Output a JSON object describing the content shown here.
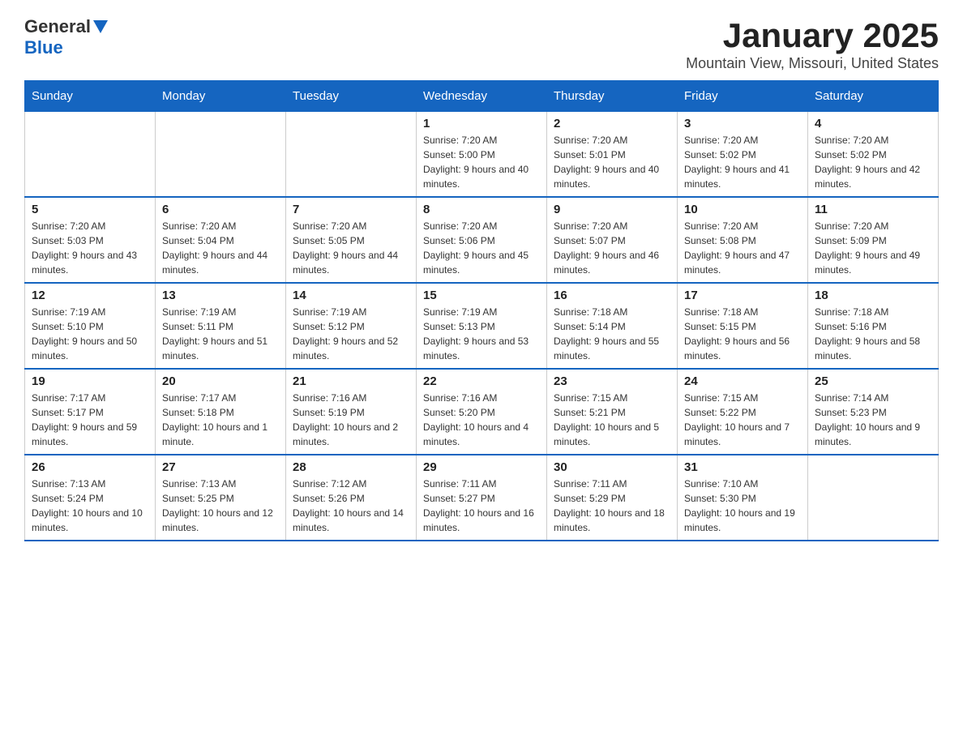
{
  "logo": {
    "text_general": "General",
    "text_blue": "Blue"
  },
  "title": "January 2025",
  "subtitle": "Mountain View, Missouri, United States",
  "days_of_week": [
    "Sunday",
    "Monday",
    "Tuesday",
    "Wednesday",
    "Thursday",
    "Friday",
    "Saturday"
  ],
  "weeks": [
    [
      {
        "day": "",
        "info": ""
      },
      {
        "day": "",
        "info": ""
      },
      {
        "day": "",
        "info": ""
      },
      {
        "day": "1",
        "info": "Sunrise: 7:20 AM\nSunset: 5:00 PM\nDaylight: 9 hours and 40 minutes."
      },
      {
        "day": "2",
        "info": "Sunrise: 7:20 AM\nSunset: 5:01 PM\nDaylight: 9 hours and 40 minutes."
      },
      {
        "day": "3",
        "info": "Sunrise: 7:20 AM\nSunset: 5:02 PM\nDaylight: 9 hours and 41 minutes."
      },
      {
        "day": "4",
        "info": "Sunrise: 7:20 AM\nSunset: 5:02 PM\nDaylight: 9 hours and 42 minutes."
      }
    ],
    [
      {
        "day": "5",
        "info": "Sunrise: 7:20 AM\nSunset: 5:03 PM\nDaylight: 9 hours and 43 minutes."
      },
      {
        "day": "6",
        "info": "Sunrise: 7:20 AM\nSunset: 5:04 PM\nDaylight: 9 hours and 44 minutes."
      },
      {
        "day": "7",
        "info": "Sunrise: 7:20 AM\nSunset: 5:05 PM\nDaylight: 9 hours and 44 minutes."
      },
      {
        "day": "8",
        "info": "Sunrise: 7:20 AM\nSunset: 5:06 PM\nDaylight: 9 hours and 45 minutes."
      },
      {
        "day": "9",
        "info": "Sunrise: 7:20 AM\nSunset: 5:07 PM\nDaylight: 9 hours and 46 minutes."
      },
      {
        "day": "10",
        "info": "Sunrise: 7:20 AM\nSunset: 5:08 PM\nDaylight: 9 hours and 47 minutes."
      },
      {
        "day": "11",
        "info": "Sunrise: 7:20 AM\nSunset: 5:09 PM\nDaylight: 9 hours and 49 minutes."
      }
    ],
    [
      {
        "day": "12",
        "info": "Sunrise: 7:19 AM\nSunset: 5:10 PM\nDaylight: 9 hours and 50 minutes."
      },
      {
        "day": "13",
        "info": "Sunrise: 7:19 AM\nSunset: 5:11 PM\nDaylight: 9 hours and 51 minutes."
      },
      {
        "day": "14",
        "info": "Sunrise: 7:19 AM\nSunset: 5:12 PM\nDaylight: 9 hours and 52 minutes."
      },
      {
        "day": "15",
        "info": "Sunrise: 7:19 AM\nSunset: 5:13 PM\nDaylight: 9 hours and 53 minutes."
      },
      {
        "day": "16",
        "info": "Sunrise: 7:18 AM\nSunset: 5:14 PM\nDaylight: 9 hours and 55 minutes."
      },
      {
        "day": "17",
        "info": "Sunrise: 7:18 AM\nSunset: 5:15 PM\nDaylight: 9 hours and 56 minutes."
      },
      {
        "day": "18",
        "info": "Sunrise: 7:18 AM\nSunset: 5:16 PM\nDaylight: 9 hours and 58 minutes."
      }
    ],
    [
      {
        "day": "19",
        "info": "Sunrise: 7:17 AM\nSunset: 5:17 PM\nDaylight: 9 hours and 59 minutes."
      },
      {
        "day": "20",
        "info": "Sunrise: 7:17 AM\nSunset: 5:18 PM\nDaylight: 10 hours and 1 minute."
      },
      {
        "day": "21",
        "info": "Sunrise: 7:16 AM\nSunset: 5:19 PM\nDaylight: 10 hours and 2 minutes."
      },
      {
        "day": "22",
        "info": "Sunrise: 7:16 AM\nSunset: 5:20 PM\nDaylight: 10 hours and 4 minutes."
      },
      {
        "day": "23",
        "info": "Sunrise: 7:15 AM\nSunset: 5:21 PM\nDaylight: 10 hours and 5 minutes."
      },
      {
        "day": "24",
        "info": "Sunrise: 7:15 AM\nSunset: 5:22 PM\nDaylight: 10 hours and 7 minutes."
      },
      {
        "day": "25",
        "info": "Sunrise: 7:14 AM\nSunset: 5:23 PM\nDaylight: 10 hours and 9 minutes."
      }
    ],
    [
      {
        "day": "26",
        "info": "Sunrise: 7:13 AM\nSunset: 5:24 PM\nDaylight: 10 hours and 10 minutes."
      },
      {
        "day": "27",
        "info": "Sunrise: 7:13 AM\nSunset: 5:25 PM\nDaylight: 10 hours and 12 minutes."
      },
      {
        "day": "28",
        "info": "Sunrise: 7:12 AM\nSunset: 5:26 PM\nDaylight: 10 hours and 14 minutes."
      },
      {
        "day": "29",
        "info": "Sunrise: 7:11 AM\nSunset: 5:27 PM\nDaylight: 10 hours and 16 minutes."
      },
      {
        "day": "30",
        "info": "Sunrise: 7:11 AM\nSunset: 5:29 PM\nDaylight: 10 hours and 18 minutes."
      },
      {
        "day": "31",
        "info": "Sunrise: 7:10 AM\nSunset: 5:30 PM\nDaylight: 10 hours and 19 minutes."
      },
      {
        "day": "",
        "info": ""
      }
    ]
  ]
}
